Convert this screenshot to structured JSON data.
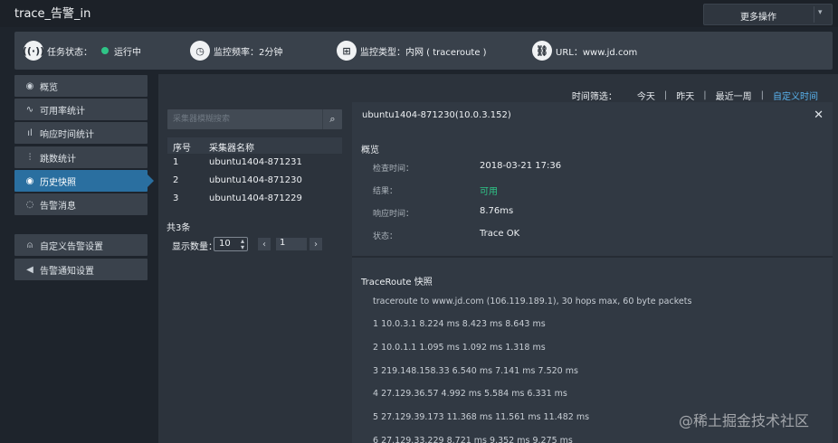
{
  "app": {
    "title": "trace_告警_in",
    "more_label": "更多操作",
    "more_caret": "▾"
  },
  "status": {
    "task_label": "任务状态：",
    "task_value": "运行中",
    "freq": "监控频率：2分钟",
    "type": "监控类型：内网 ( traceroute )",
    "url": "URL：www.jd.com",
    "icons": [
      "radio-tower-icon",
      "clock-icon",
      "grid-icon",
      "link-icon"
    ],
    "running_color": "#2fc487"
  },
  "nav": {
    "items": [
      {
        "label": "概览",
        "icon": "◉"
      },
      {
        "label": "可用率统计",
        "icon": "∿"
      },
      {
        "label": "响应时间统计",
        "icon": "ıl"
      },
      {
        "label": "跳数统计",
        "icon": "⫶"
      },
      {
        "label": "历史快照",
        "icon": "◉"
      },
      {
        "label": "告警消息",
        "icon": "◌"
      },
      {
        "label": "自定义告警设置",
        "icon": "⍝"
      },
      {
        "label": "告警通知设置",
        "icon": "◀"
      }
    ],
    "active_index": 4,
    "active_color": "#2a6fa0"
  },
  "filter": {
    "label": "时间筛选：",
    "options": [
      "今天",
      "昨天",
      "最近一周",
      "自定义时间"
    ],
    "separator": "|",
    "active": "自定义时间",
    "active_color": "#59b3ee"
  },
  "collectors": {
    "search_placeholder": "采集器模糊搜索",
    "columns": [
      "序号",
      "采集器名称"
    ],
    "rows": [
      {
        "no": "1",
        "name": "ubuntu1404-871231"
      },
      {
        "no": "2",
        "name": "ubuntu1404-871230"
      },
      {
        "no": "3",
        "name": "ubuntu1404-871229"
      }
    ],
    "total": "共3条",
    "page_size_label": "显示数量：",
    "page_size": "10",
    "page": "1"
  },
  "detail": {
    "title": "ubuntu1404-871230(10.0.3.152)",
    "overview_title": "概览",
    "fields": [
      {
        "key": "检查时间：",
        "value": "2018-03-21 17:36"
      },
      {
        "key": "结果：",
        "value": "可用"
      },
      {
        "key": "响应时间：",
        "value": "8.76ms"
      },
      {
        "key": "状态：",
        "value": "Trace OK"
      }
    ],
    "traceroute_title": "TraceRoute 快照",
    "traceroute_lines": [
      "traceroute to www.jd.com (106.119.189.1), 30 hops max, 60 byte packets",
      "1 10.0.3.1 8.224 ms 8.423 ms 8.643 ms",
      "2 10.0.1.1 1.095 ms 1.092 ms 1.318 ms",
      "3 219.148.158.33 6.540 ms 7.141 ms 7.520 ms",
      "4 27.129.36.57 4.992 ms 5.584 ms 6.331 ms",
      "5 27.129.39.173 11.368 ms 11.561 ms 11.482 ms",
      "6 27.129.33.229 8.721 ms 9.352 ms 9.275 ms"
    ]
  },
  "watermark": "@稀土掘金技术社区"
}
